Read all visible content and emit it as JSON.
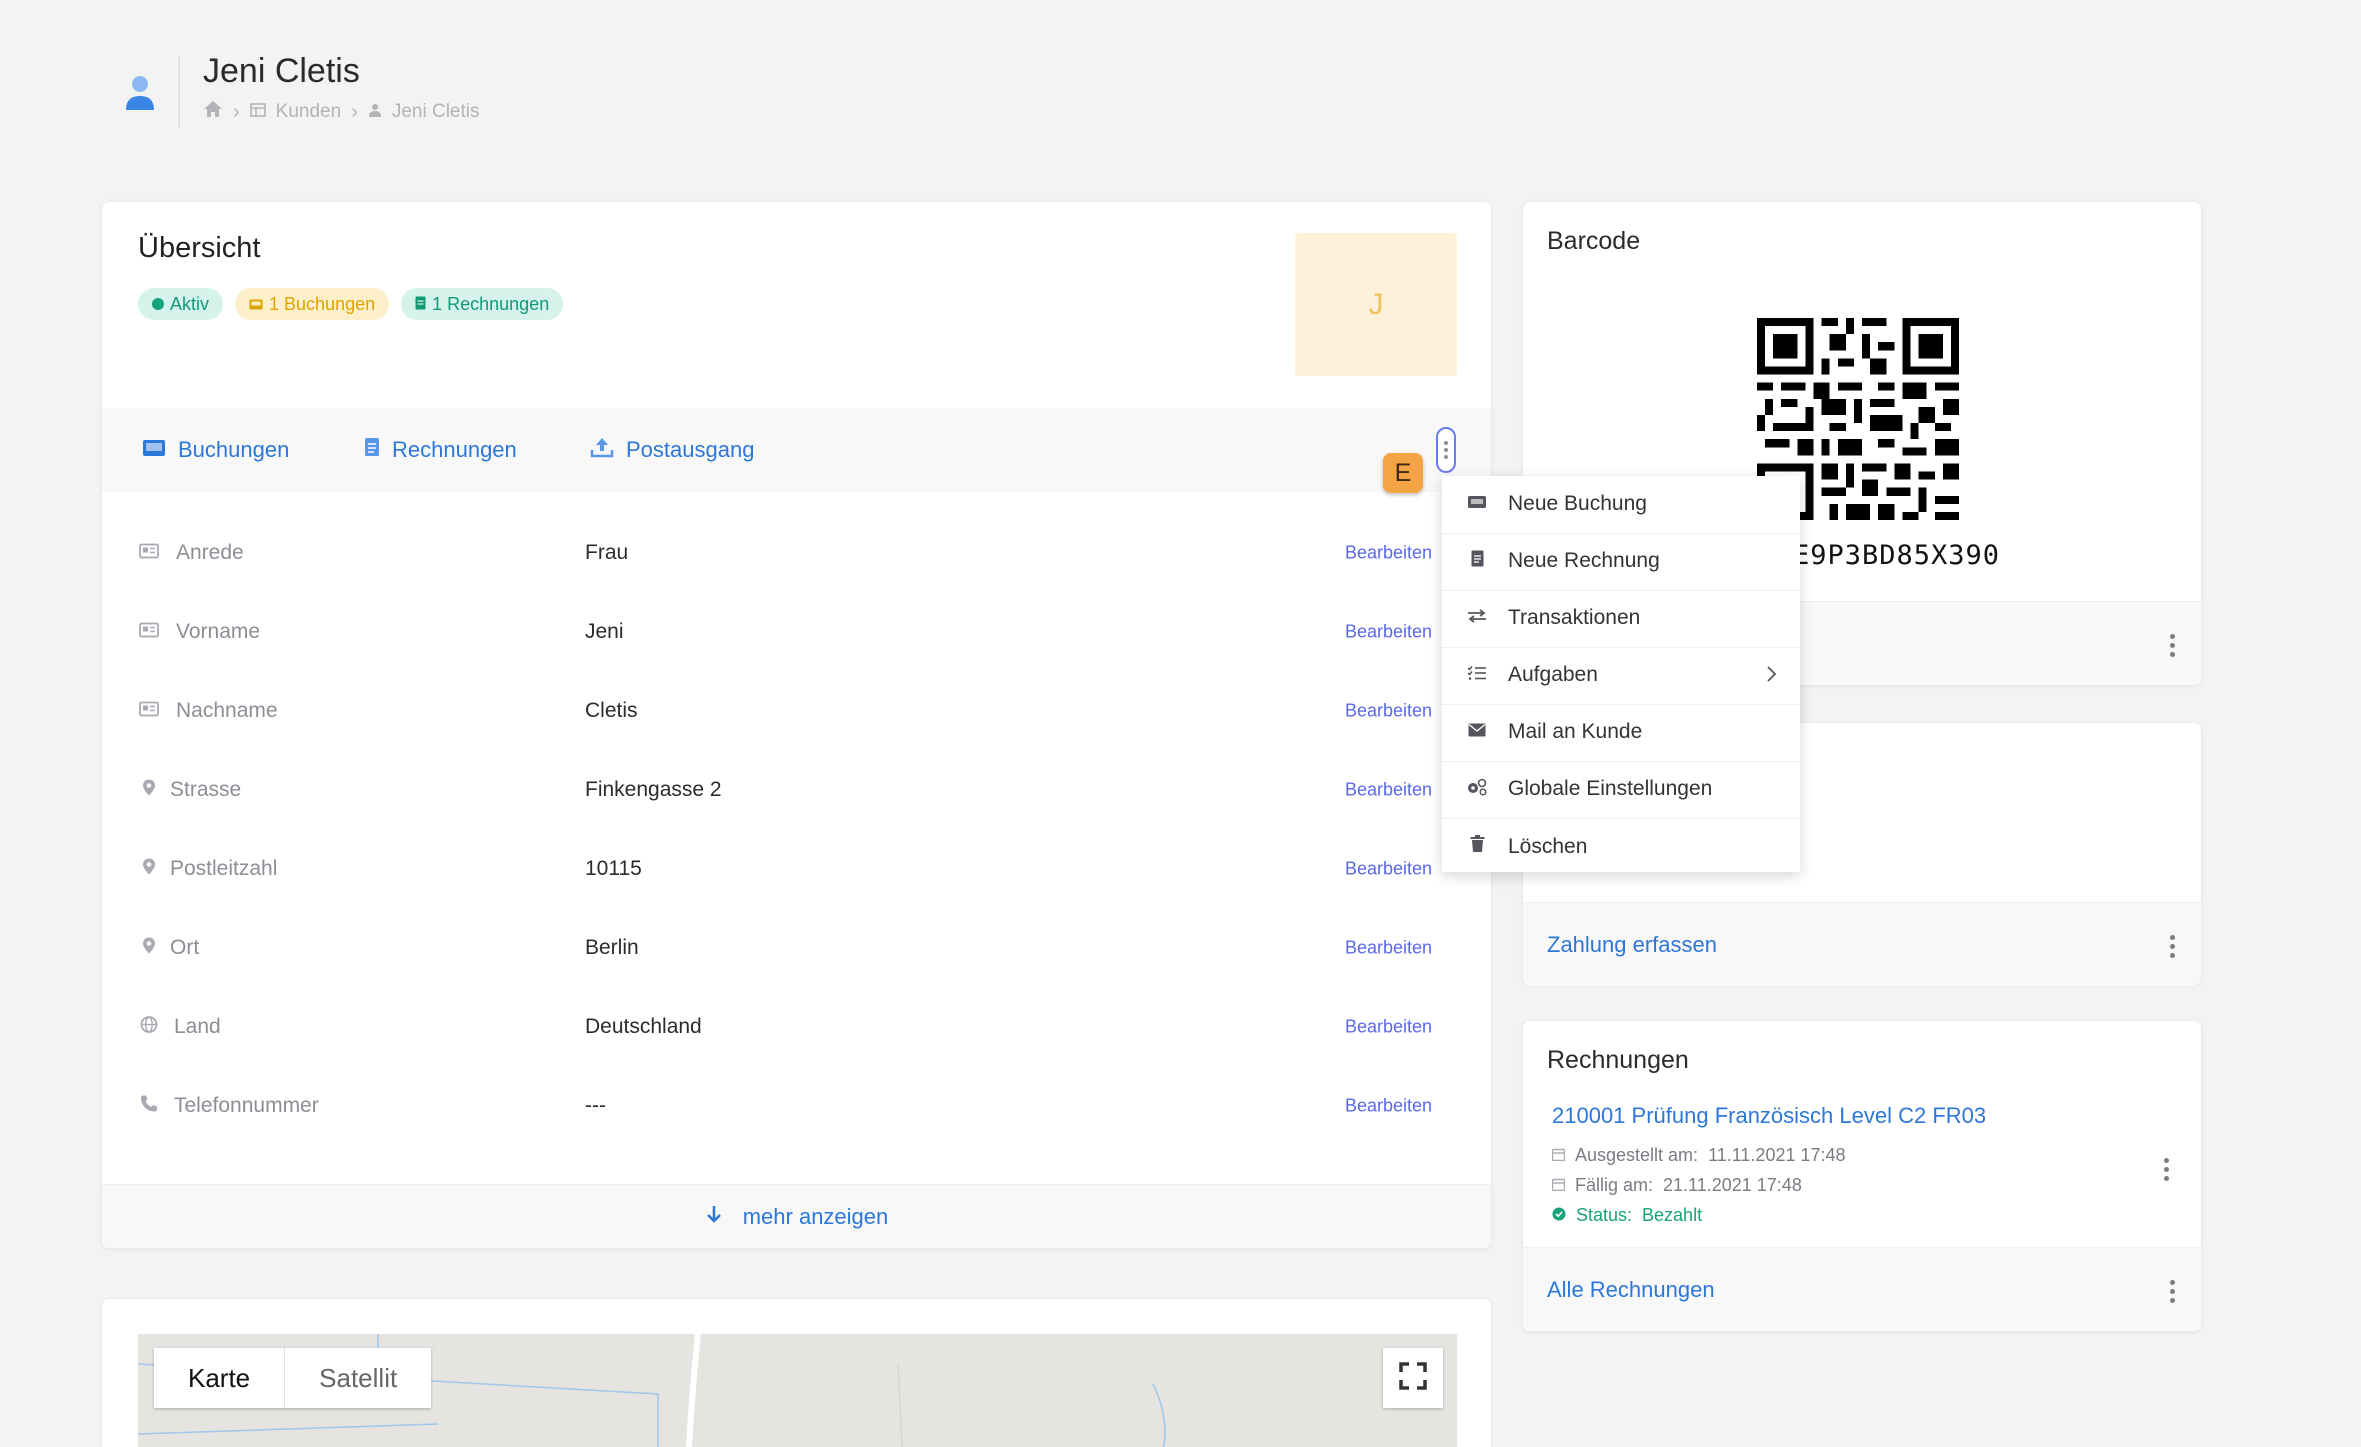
{
  "header": {
    "title": "Jeni Cletis",
    "breadcrumb": [
      "Kunden",
      "Jeni Cletis"
    ]
  },
  "overview": {
    "title": "Übersicht",
    "badges": [
      {
        "label": "Aktiv"
      },
      {
        "label": "1 Buchungen"
      },
      {
        "label": "1 Rechnungen"
      }
    ],
    "avatar_letter": "J",
    "tabs": [
      "Buchungen",
      "Rechnungen",
      "Postausgang"
    ],
    "hint_key": "E",
    "edit_label": "Bearbeiten",
    "fields": [
      {
        "icon": "id-card-icon",
        "label": "Anrede",
        "value": "Frau"
      },
      {
        "icon": "id-card-icon",
        "label": "Vorname",
        "value": "Jeni"
      },
      {
        "icon": "id-card-icon",
        "label": "Nachname",
        "value": "Cletis"
      },
      {
        "icon": "map-pin-icon",
        "label": "Strasse",
        "value": "Finkengasse 2"
      },
      {
        "icon": "map-pin-icon",
        "label": "Postleitzahl",
        "value": "10115"
      },
      {
        "icon": "map-pin-icon",
        "label": "Ort",
        "value": "Berlin"
      },
      {
        "icon": "globe-icon",
        "label": "Land",
        "value": "Deutschland"
      },
      {
        "icon": "phone-icon",
        "label": "Telefonnummer",
        "value": "---"
      }
    ],
    "more_label": "mehr anzeigen"
  },
  "menu": {
    "items": [
      {
        "label": "Neue Buchung",
        "icon": "booking-icon"
      },
      {
        "label": "Neue Rechnung",
        "icon": "invoice-icon"
      },
      {
        "label": "Transaktionen",
        "icon": "transfer-icon"
      },
      {
        "label": "Aufgaben",
        "icon": "tasks-icon",
        "submenu": true
      },
      {
        "label": "Mail an Kunde",
        "icon": "mail-icon"
      },
      {
        "label": "Globale Einstellungen",
        "icon": "gears-icon"
      },
      {
        "label": "Löschen",
        "icon": "trash-icon"
      }
    ]
  },
  "barcode": {
    "title": "Barcode",
    "code_visible": "E9P3BD85X390"
  },
  "payment": {
    "link": "Zahlung erfassen"
  },
  "invoices": {
    "title": "Rechnungen",
    "item_title": "210001 Prüfung Französisch Level C2 FR03",
    "issued_label": "Ausgestellt am:",
    "issued_value": "11.11.2021 17:48",
    "due_label": "Fällig am:",
    "due_value": "21.11.2021 17:48",
    "status_label": "Status:",
    "status_value": "Bezahlt",
    "all_link": "Alle Rechnungen"
  },
  "map": {
    "tab_map": "Karte",
    "tab_satellite": "Satellit"
  },
  "colors": {
    "accent": "#2c77d8",
    "edit": "#5a68e8",
    "success": "#16a37a",
    "warning": "#e0a400"
  }
}
